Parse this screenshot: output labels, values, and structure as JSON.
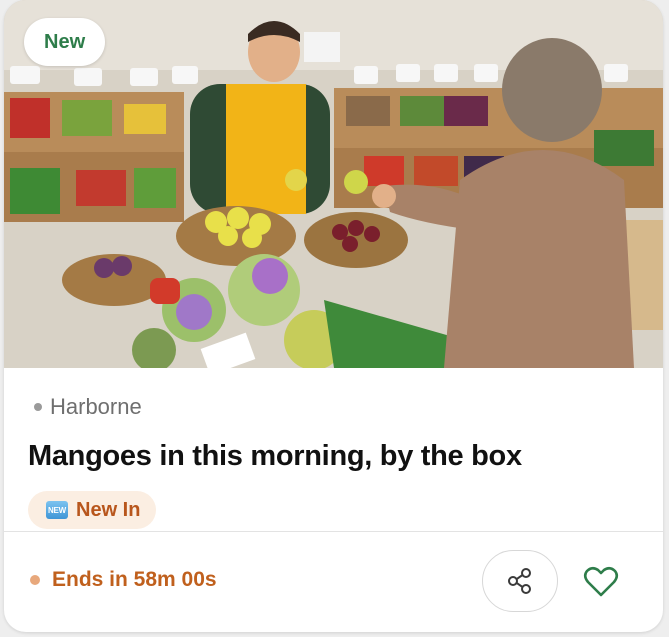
{
  "badge": {
    "label": "New"
  },
  "listing": {
    "location": "Harborne",
    "title": "Mangoes in this morning, by the box",
    "tag": {
      "icon_text": "NEW",
      "label": "New In"
    }
  },
  "footer": {
    "ends_label": "Ends in 58m 00s",
    "share_icon": "share-icon",
    "favorite_icon": "heart-icon"
  },
  "colors": {
    "badge_text": "#2e7d4a",
    "tag_bg": "#fbeee2",
    "tag_text": "#b8561c",
    "ends_text": "#c0601d",
    "ends_dot": "#e8a87c",
    "heart": "#2e7d4a"
  }
}
